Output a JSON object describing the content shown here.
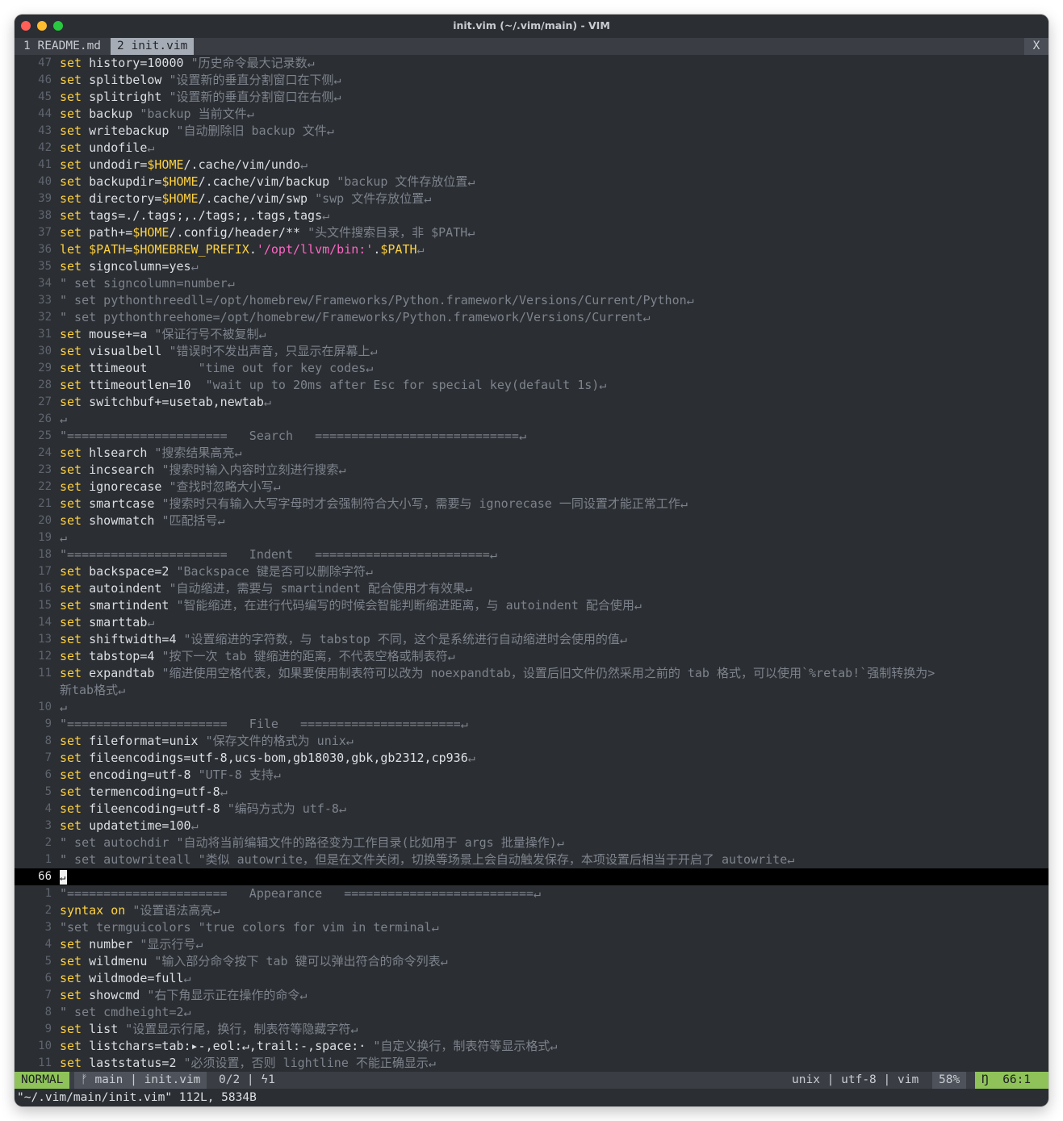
{
  "window": {
    "title": "init.vim (~/.vim/main) - VIM",
    "traffic_lights": {
      "close": "#ff5f57",
      "minimize": "#febc2e",
      "zoom": "#28c840"
    }
  },
  "tabline": {
    "tabs": [
      {
        "label": "1 README.md"
      },
      {
        "label": "2 init.vim"
      }
    ],
    "close_label": "X"
  },
  "buffer": {
    "lines": [
      {
        "num": "47",
        "parts": [
          [
            "kw",
            "set"
          ],
          [
            "t",
            " history=10000 "
          ],
          [
            "cm",
            "\"历史命令最大记录数↵"
          ]
        ]
      },
      {
        "num": "46",
        "parts": [
          [
            "kw",
            "set"
          ],
          [
            "t",
            " splitbelow "
          ],
          [
            "cm",
            "\"设置新的垂直分割窗口在下侧↵"
          ]
        ]
      },
      {
        "num": "45",
        "parts": [
          [
            "kw",
            "set"
          ],
          [
            "t",
            " splitright "
          ],
          [
            "cm",
            "\"设置新的垂直分割窗口在右侧↵"
          ]
        ]
      },
      {
        "num": "44",
        "parts": [
          [
            "kw",
            "set"
          ],
          [
            "t",
            " backup "
          ],
          [
            "cm",
            "\"backup 当前文件↵"
          ]
        ]
      },
      {
        "num": "43",
        "parts": [
          [
            "kw",
            "set"
          ],
          [
            "t",
            " writebackup "
          ],
          [
            "cm",
            "\"自动删除旧 backup 文件↵"
          ]
        ]
      },
      {
        "num": "42",
        "parts": [
          [
            "kw",
            "set"
          ],
          [
            "t",
            " undofile"
          ],
          [
            "cm",
            "↵"
          ]
        ]
      },
      {
        "num": "41",
        "parts": [
          [
            "kw",
            "set"
          ],
          [
            "t",
            " undodir="
          ],
          [
            "kw",
            "$HOME"
          ],
          [
            "t",
            "/.cache/vim/undo"
          ],
          [
            "cm",
            "↵"
          ]
        ]
      },
      {
        "num": "40",
        "parts": [
          [
            "kw",
            "set"
          ],
          [
            "t",
            " backupdir="
          ],
          [
            "kw",
            "$HOME"
          ],
          [
            "t",
            "/.cache/vim/backup "
          ],
          [
            "cm",
            "\"backup 文件存放位置↵"
          ]
        ]
      },
      {
        "num": "39",
        "parts": [
          [
            "kw",
            "set"
          ],
          [
            "t",
            " directory="
          ],
          [
            "kw",
            "$HOME"
          ],
          [
            "t",
            "/.cache/vim/swp "
          ],
          [
            "cm",
            "\"swp 文件存放位置↵"
          ]
        ]
      },
      {
        "num": "38",
        "parts": [
          [
            "kw",
            "set"
          ],
          [
            "t",
            " tags=./.tags;,./tags;,.tags,tags"
          ],
          [
            "cm",
            "↵"
          ]
        ]
      },
      {
        "num": "37",
        "parts": [
          [
            "kw",
            "set"
          ],
          [
            "t",
            " path+="
          ],
          [
            "kw",
            "$HOME"
          ],
          [
            "t",
            "/.config/header/** "
          ],
          [
            "cm",
            "\"头文件搜索目录，非 $PATH↵"
          ]
        ]
      },
      {
        "num": "36",
        "parts": [
          [
            "kw",
            "let"
          ],
          [
            "t",
            " "
          ],
          [
            "kw",
            "$PATH"
          ],
          [
            "t",
            "="
          ],
          [
            "kw",
            "$HOMEBREW_PREFIX"
          ],
          [
            "t",
            "."
          ],
          [
            "str",
            "'/opt/llvm/bin:'"
          ],
          [
            "t",
            "."
          ],
          [
            "kw",
            "$PATH"
          ],
          [
            "cm",
            "↵"
          ]
        ]
      },
      {
        "num": "35",
        "parts": [
          [
            "kw",
            "set"
          ],
          [
            "t",
            " signcolumn=yes"
          ],
          [
            "cm",
            "↵"
          ]
        ]
      },
      {
        "num": "34",
        "parts": [
          [
            "cm",
            "\" set signcolumn=number↵"
          ]
        ]
      },
      {
        "num": "33",
        "parts": [
          [
            "cm",
            "\" set pythonthreedll=/opt/homebrew/Frameworks/Python.framework/Versions/Current/Python↵"
          ]
        ]
      },
      {
        "num": "32",
        "parts": [
          [
            "cm",
            "\" set pythonthreehome=/opt/homebrew/Frameworks/Python.framework/Versions/Current↵"
          ]
        ]
      },
      {
        "num": "31",
        "parts": [
          [
            "kw",
            "set"
          ],
          [
            "t",
            " mouse+=a "
          ],
          [
            "cm",
            "\"保证行号不被复制↵"
          ]
        ]
      },
      {
        "num": "30",
        "parts": [
          [
            "kw",
            "set"
          ],
          [
            "t",
            " visualbell "
          ],
          [
            "cm",
            "\"错误时不发出声音，只显示在屏幕上↵"
          ]
        ]
      },
      {
        "num": "29",
        "parts": [
          [
            "kw",
            "set"
          ],
          [
            "t",
            " ttimeout "
          ],
          [
            "cm",
            "      \"time out for key codes↵"
          ]
        ]
      },
      {
        "num": "28",
        "parts": [
          [
            "kw",
            "set"
          ],
          [
            "t",
            " ttimeoutlen=10  "
          ],
          [
            "cm",
            "\"wait up to 20ms after Esc for special key(default 1s)↵"
          ]
        ]
      },
      {
        "num": "27",
        "parts": [
          [
            "kw",
            "set"
          ],
          [
            "t",
            " switchbuf+=usetab,newtab"
          ],
          [
            "cm",
            "↵"
          ]
        ]
      },
      {
        "num": "26",
        "parts": [
          [
            "cm",
            "↵"
          ]
        ]
      },
      {
        "num": "25",
        "parts": [
          [
            "cm",
            "\"======================   Search   ============================↵"
          ]
        ]
      },
      {
        "num": "24",
        "parts": [
          [
            "kw",
            "set"
          ],
          [
            "t",
            " hlsearch "
          ],
          [
            "cm",
            "\"搜索结果高亮↵"
          ]
        ]
      },
      {
        "num": "23",
        "parts": [
          [
            "kw",
            "set"
          ],
          [
            "t",
            " incsearch "
          ],
          [
            "cm",
            "\"搜索时输入内容时立刻进行搜索↵"
          ]
        ]
      },
      {
        "num": "22",
        "parts": [
          [
            "kw",
            "set"
          ],
          [
            "t",
            " ignorecase "
          ],
          [
            "cm",
            "\"查找时忽略大小写↵"
          ]
        ]
      },
      {
        "num": "21",
        "parts": [
          [
            "kw",
            "set"
          ],
          [
            "t",
            " smartcase "
          ],
          [
            "cm",
            "\"搜索时只有输入大写字母时才会强制符合大小写，需要与 ignorecase 一同设置才能正常工作↵"
          ]
        ]
      },
      {
        "num": "20",
        "parts": [
          [
            "kw",
            "set"
          ],
          [
            "t",
            " showmatch "
          ],
          [
            "cm",
            "\"匹配括号↵"
          ]
        ]
      },
      {
        "num": "19",
        "parts": [
          [
            "cm",
            "↵"
          ]
        ]
      },
      {
        "num": "18",
        "parts": [
          [
            "cm",
            "\"======================   Indent   ========================↵"
          ]
        ]
      },
      {
        "num": "17",
        "parts": [
          [
            "kw",
            "set"
          ],
          [
            "t",
            " backspace=2 "
          ],
          [
            "cm",
            "\"Backspace 键是否可以删除字符↵"
          ]
        ]
      },
      {
        "num": "16",
        "parts": [
          [
            "kw",
            "set"
          ],
          [
            "t",
            " autoindent "
          ],
          [
            "cm",
            "\"自动缩进，需要与 smartindent 配合使用才有效果↵"
          ]
        ]
      },
      {
        "num": "15",
        "parts": [
          [
            "kw",
            "set"
          ],
          [
            "t",
            " smartindent "
          ],
          [
            "cm",
            "\"智能缩进，在进行代码编写的时候会智能判断缩进距离，与 autoindent 配合使用↵"
          ]
        ]
      },
      {
        "num": "14",
        "parts": [
          [
            "kw",
            "set"
          ],
          [
            "t",
            " smarttab"
          ],
          [
            "cm",
            "↵"
          ]
        ]
      },
      {
        "num": "13",
        "parts": [
          [
            "kw",
            "set"
          ],
          [
            "t",
            " shiftwidth=4 "
          ],
          [
            "cm",
            "\"设置缩进的字符数，与 tabstop 不同，这个是系统进行自动缩进时会使用的值↵"
          ]
        ]
      },
      {
        "num": "12",
        "parts": [
          [
            "kw",
            "set"
          ],
          [
            "t",
            " tabstop=4 "
          ],
          [
            "cm",
            "\"按下一次 tab 键缩进的距离，不代表空格或制表符↵"
          ]
        ]
      },
      {
        "num": "11",
        "parts": [
          [
            "kw",
            "set"
          ],
          [
            "t",
            " expandtab "
          ],
          [
            "cm",
            "\"缩进使用空格代表，如果要使用制表符可以改为 noexpandtab，设置后旧文件仍然采用之前的 tab 格式，可以使用`%retab!`强制转换为>"
          ]
        ]
      },
      {
        "num": "",
        "parts": [
          [
            "cm",
            "新tab格式↵"
          ]
        ]
      },
      {
        "num": "10",
        "parts": [
          [
            "cm",
            "↵"
          ]
        ]
      },
      {
        "num": "9",
        "parts": [
          [
            "cm",
            "\"======================   File   ======================↵"
          ]
        ]
      },
      {
        "num": "8",
        "parts": [
          [
            "kw",
            "set"
          ],
          [
            "t",
            " fileformat=unix "
          ],
          [
            "cm",
            "\"保存文件的格式为 unix↵"
          ]
        ]
      },
      {
        "num": "7",
        "parts": [
          [
            "kw",
            "set"
          ],
          [
            "t",
            " fileencodings=utf-8,ucs-bom,gb18030,gbk,gb2312,cp936"
          ],
          [
            "cm",
            "↵"
          ]
        ]
      },
      {
        "num": "6",
        "parts": [
          [
            "kw",
            "set"
          ],
          [
            "t",
            " encoding=utf-8 "
          ],
          [
            "cm",
            "\"UTF-8 支持↵"
          ]
        ]
      },
      {
        "num": "5",
        "parts": [
          [
            "kw",
            "set"
          ],
          [
            "t",
            " termencoding=utf-8"
          ],
          [
            "cm",
            "↵"
          ]
        ]
      },
      {
        "num": "4",
        "parts": [
          [
            "kw",
            "set"
          ],
          [
            "t",
            " fileencoding=utf-8 "
          ],
          [
            "cm",
            "\"编码方式为 utf-8↵"
          ]
        ]
      },
      {
        "num": "3",
        "parts": [
          [
            "kw",
            "set"
          ],
          [
            "t",
            " updatetime=100"
          ],
          [
            "cm",
            "↵"
          ]
        ]
      },
      {
        "num": "2",
        "parts": [
          [
            "cm",
            "\" set autochdir \"自动将当前编辑文件的路径变为工作目录(比如用于 args 批量操作)↵"
          ]
        ]
      },
      {
        "num": "1",
        "parts": [
          [
            "cm",
            "\" set autowriteall \"类似 autowrite，但是在文件关闭，切换等场景上会自动触发保存，本项设置后相当于开启了 autowrite↵"
          ]
        ]
      },
      {
        "num": "66",
        "current": true,
        "parts": [
          [
            "cursor",
            "↵"
          ]
        ]
      },
      {
        "num": "1",
        "parts": [
          [
            "cm",
            "\"======================   Appearance   ==========================↵"
          ]
        ]
      },
      {
        "num": "2",
        "parts": [
          [
            "kw",
            "syntax"
          ],
          [
            "t",
            " "
          ],
          [
            "kw",
            "on"
          ],
          [
            "t",
            " "
          ],
          [
            "cm",
            "\"设置语法高亮↵"
          ]
        ]
      },
      {
        "num": "3",
        "parts": [
          [
            "cm",
            "\"set termguicolors \"true colors for vim in terminal↵"
          ]
        ]
      },
      {
        "num": "4",
        "parts": [
          [
            "kw",
            "set"
          ],
          [
            "t",
            " number "
          ],
          [
            "cm",
            "\"显示行号↵"
          ]
        ]
      },
      {
        "num": "5",
        "parts": [
          [
            "kw",
            "set"
          ],
          [
            "t",
            " wildmenu "
          ],
          [
            "cm",
            "\"输入部分命令按下 tab 键可以弹出符合的命令列表↵"
          ]
        ]
      },
      {
        "num": "6",
        "parts": [
          [
            "kw",
            "set"
          ],
          [
            "t",
            " wildmode=full"
          ],
          [
            "cm",
            "↵"
          ]
        ]
      },
      {
        "num": "7",
        "parts": [
          [
            "kw",
            "set"
          ],
          [
            "t",
            " showcmd "
          ],
          [
            "cm",
            "\"右下角显示正在操作的命令↵"
          ]
        ]
      },
      {
        "num": "8",
        "parts": [
          [
            "cm",
            "\" set cmdheight=2↵"
          ]
        ]
      },
      {
        "num": "9",
        "parts": [
          [
            "kw",
            "set"
          ],
          [
            "t",
            " list "
          ],
          [
            "cm",
            "\"设置显示行尾，换行，制表符等隐藏字符↵"
          ]
        ]
      },
      {
        "num": "10",
        "parts": [
          [
            "kw",
            "set"
          ],
          [
            "t",
            " listchars=tab:▸-,eol:↵,trail:-,space:· "
          ],
          [
            "cm",
            "\"自定义换行，制表符等显示格式↵"
          ]
        ]
      },
      {
        "num": "11",
        "parts": [
          [
            "kw",
            "set"
          ],
          [
            "t",
            " laststatus=2 "
          ],
          [
            "cm",
            "\"必须设置，否则 lightline 不能正确显示↵"
          ]
        ]
      }
    ]
  },
  "statusline": {
    "mode": "NORMAL",
    "branch_icon": "git-branch-icon",
    "branch": "main",
    "filename": "init.vim",
    "diag_count": "0/2",
    "bolt_icon": "lightning-icon",
    "bolt_count": "1",
    "fileformat": "unix",
    "encoding": "utf-8",
    "filetype": "vim",
    "percent": "58%",
    "line_icon": "line-number-icon",
    "position": "66:1"
  },
  "cmdline": {
    "text": "\"~/.vim/main/init.vim\" 112L, 5834B"
  },
  "colors": {
    "keyword": "#ffd23f",
    "comment": "#7d838c",
    "string": "#ff66c4",
    "mode_bg": "#8fc35a",
    "background": "#2b2e33"
  }
}
